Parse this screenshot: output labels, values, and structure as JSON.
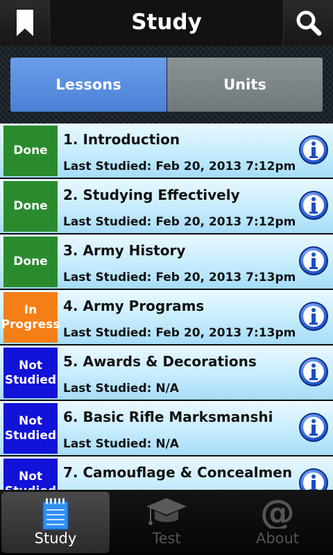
{
  "header": {
    "title": "Study",
    "left_icon": "bookmark-icon",
    "right_icon": "search-icon"
  },
  "segments": {
    "lessons": "Lessons",
    "units": "Units",
    "selected": "Lessons"
  },
  "lessons": [
    {
      "status": "Done",
      "title": "1. Introduction",
      "last": "Last Studied: Feb 20, 2013 7:12pm"
    },
    {
      "status": "Done",
      "title": "2. Studying Effectively",
      "last": "Last Studied: Feb 20, 2013 7:12pm"
    },
    {
      "status": "Done",
      "title": "3. Army History",
      "last": "Last Studied: Feb 20, 2013 7:13pm"
    },
    {
      "status": "In Progress",
      "title": "4. Army Programs",
      "last": "Last Studied: Feb 20, 2013 7:13pm"
    },
    {
      "status": "Not Studied",
      "title": "5. Awards & Decorations",
      "last": "Last Studied: N/A"
    },
    {
      "status": "Not Studied",
      "title": "6. Basic Rifle Marksmanshi",
      "last": "Last Studied: N/A"
    },
    {
      "status": "Not Studied",
      "title": "7. Camouflage & Concealmen",
      "last": ""
    }
  ],
  "tabs": [
    {
      "label": "Study",
      "icon": "notepad-icon",
      "active": true
    },
    {
      "label": "Test",
      "icon": "graduation-cap-icon",
      "active": false
    },
    {
      "label": "About",
      "icon": "at-sign-icon",
      "active": false
    }
  ],
  "colors": {
    "done": "#2a8b2e",
    "in_progress": "#f57f17",
    "not_studied": "#1212d8",
    "segment_active": "#5b8fe0"
  }
}
